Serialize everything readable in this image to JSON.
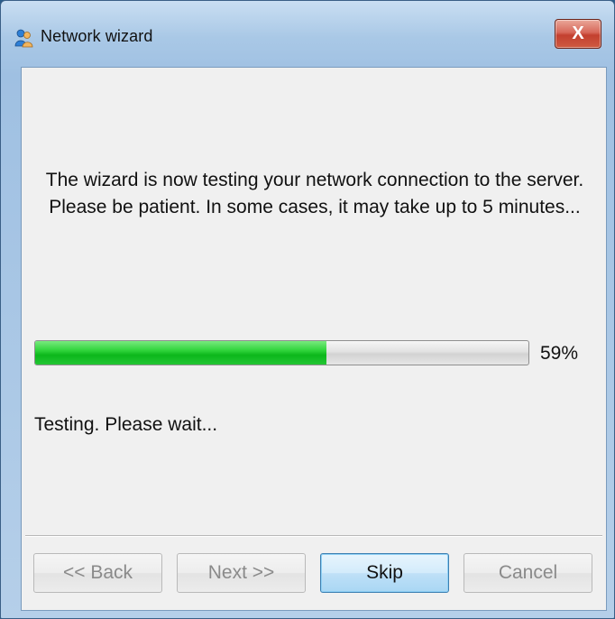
{
  "window": {
    "title": "Network wizard",
    "close_label": "X",
    "icon": "people-icon"
  },
  "content": {
    "message": "The wizard is now testing your network connection to the server.  Please be patient.  In some cases, it may take up to 5 minutes...",
    "progress": {
      "fraction": 0.59,
      "label": "59%"
    },
    "status": "Testing.  Please wait..."
  },
  "buttons": {
    "back": {
      "label": "<< Back",
      "enabled": false
    },
    "next": {
      "label": "Next >>",
      "enabled": false
    },
    "skip": {
      "label": "Skip",
      "enabled": true
    },
    "cancel": {
      "label": "Cancel",
      "enabled": false
    }
  },
  "colors": {
    "progress_fill": "#12bf22",
    "close_button": "#c94a36",
    "default_button": "#a9d7f4"
  }
}
